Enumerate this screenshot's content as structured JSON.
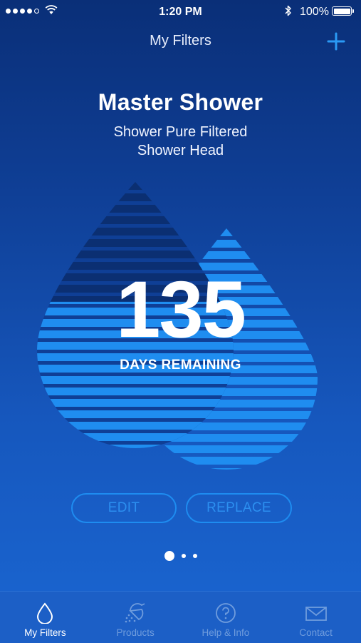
{
  "status_bar": {
    "time": "1:20 PM",
    "battery": "100%"
  },
  "nav": {
    "title": "My Filters",
    "add_icon": "plus-icon"
  },
  "filter": {
    "name": "Master Shower",
    "description_line1": "Shower Pure Filtered",
    "description_line2": "Shower Head",
    "days_remaining": "135",
    "days_label": "DAYS REMAINING",
    "life_remaining_fraction": 0.55
  },
  "actions": {
    "edit_label": "EDIT",
    "replace_label": "REPLACE"
  },
  "pagination": {
    "total": 3,
    "current": 1
  },
  "tabs": [
    {
      "label": "My Filters",
      "icon": "water-drop-icon",
      "active": true
    },
    {
      "label": "Products",
      "icon": "shower-head-icon",
      "active": false
    },
    {
      "label": "Help & Info",
      "icon": "question-circle-icon",
      "active": false
    },
    {
      "label": "Contact",
      "icon": "envelope-icon",
      "active": false
    }
  ],
  "colors": {
    "background_top": "#0a2f78",
    "background_bottom": "#1a66d2",
    "drop_dark": "#0b2f72",
    "drop_light": "#1f8df0",
    "accent": "#1e8cf0",
    "tab_inactive": "#6f9cdd"
  }
}
